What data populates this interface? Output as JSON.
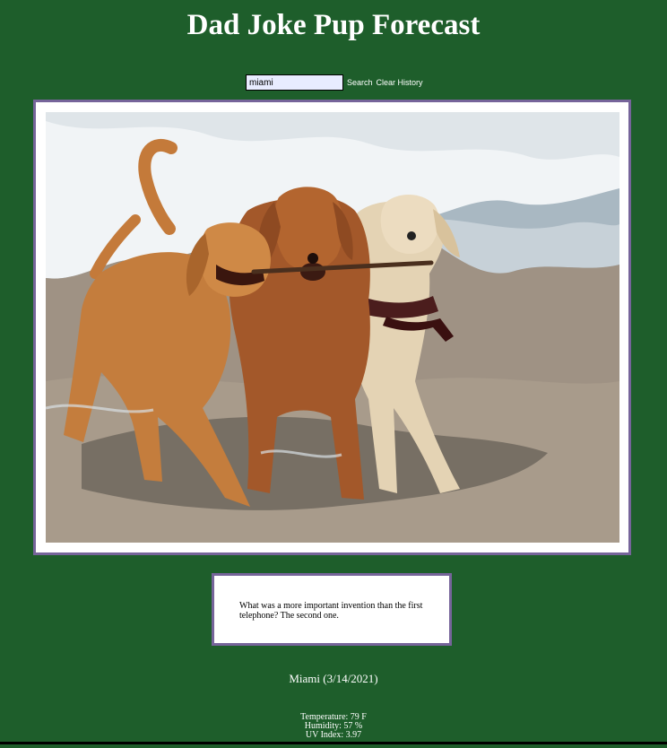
{
  "header": {
    "title": "Dad Joke Pup Forecast"
  },
  "search": {
    "value": "miami",
    "search_label": "Search",
    "clear_label": "Clear History"
  },
  "photo": {
    "alt": "Three dogs playing at the beach carrying a stick",
    "colors": {
      "sea": "#a7b5bd",
      "foam": "#f2f5f6",
      "sand": "#9e9182",
      "golden_dog": "#c77f3d",
      "red_dog": "#a65a2a",
      "yellow_dog": "#e8d7b8"
    }
  },
  "joke": {
    "text": "What was a more important invention than the first telephone? The second one."
  },
  "weather": {
    "city_date": "Miami (3/14/2021)",
    "temperature": "Temperature: 79 F",
    "humidity": "Humidity: 57 %",
    "uv_index": "UV Index: 3.97"
  },
  "theme": {
    "background": "#1e5e2b",
    "frame_border": "#76649a",
    "input_bg": "#e8ecff"
  }
}
